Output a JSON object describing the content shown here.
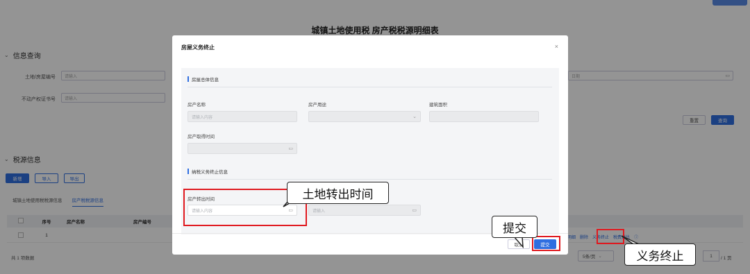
{
  "page": {
    "title": "城镇土地使用税 房产税税源明细表",
    "query_section": "信息查询",
    "source_section": "税源信息",
    "fields": [
      {
        "label": "土地/房屋编号",
        "placeholder": "请输入"
      },
      {
        "label": "不动产权证书号",
        "placeholder": "请输入"
      }
    ],
    "right_field_placeholder": "日期",
    "reset_label": "重置",
    "query_label": "查询",
    "actions": {
      "add": "新增",
      "import": "导入",
      "export": "导出"
    },
    "tabs": [
      "城镇土地使用税税源信息",
      "房产税税源信息"
    ],
    "table": {
      "headers": [
        "序号",
        "房产名称",
        "房产编号"
      ],
      "rows": [
        {
          "index": "1"
        }
      ],
      "row_links": [
        "明细",
        "删除",
        "义务终止",
        "税费对比"
      ]
    },
    "footer_count": "共 1 项数据",
    "page_size": "5条/页",
    "page_no": "1",
    "page_total": "/ 1 页"
  },
  "modal": {
    "title": "房屋义务终止",
    "close_icon": "×",
    "group1": "房屋总体信息",
    "name_label": "房产名称",
    "name_placeholder": "请输入内容",
    "use_label": "房产用途",
    "area_label": "建筑面积",
    "acquire_label": "房产取得时间",
    "group2": "纳税义务终止信息",
    "transfer_label": "房产转出时间",
    "transfer_placeholder": "请输入内容",
    "second_placeholder": "请输入",
    "cancel_label": "取消",
    "submit_label": "提交"
  },
  "annotations": {
    "transfer_time": "土地转出时间",
    "submit": "提交",
    "terminate": "义务终止"
  },
  "colors": {
    "accent": "#2f6ee0",
    "highlight": "#e0191f"
  }
}
